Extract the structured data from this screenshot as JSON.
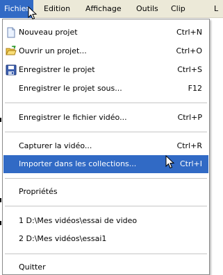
{
  "menubar": {
    "items": [
      {
        "label": "Fichier"
      },
      {
        "label": "Edition"
      },
      {
        "label": "Affichage"
      },
      {
        "label": "Outils"
      },
      {
        "label": "Clip"
      },
      {
        "label": "L"
      }
    ]
  },
  "menu": {
    "items": [
      {
        "label": "Nouveau projet",
        "shortcut": "Ctrl+N",
        "icon": "new-project-icon"
      },
      {
        "label": "Ouvrir un projet...",
        "shortcut": "Ctrl+O",
        "icon": "open-folder-icon"
      },
      {
        "label": "Enregistrer le projet",
        "shortcut": "Ctrl+S",
        "icon": "save-disk-icon"
      },
      {
        "label": "Enregistrer le projet sous...",
        "shortcut": "F12"
      },
      {
        "label": "Enregistrer le fichier vidéo...",
        "shortcut": "Ctrl+P"
      },
      {
        "label": "Capturer la vidéo...",
        "shortcut": "Ctrl+R"
      },
      {
        "label": "Importer dans les collections...",
        "shortcut": "Ctrl+I",
        "highlighted": true
      },
      {
        "label": "Propriétés"
      },
      {
        "label": "1 D:\\Mes vidéos\\essai de video"
      },
      {
        "label": "2 D:\\Mes vidéos\\essai1"
      },
      {
        "label": "Quitter"
      }
    ]
  },
  "colors": {
    "highlight": "#316ac5",
    "menubar_bg": "#ece9d8"
  }
}
